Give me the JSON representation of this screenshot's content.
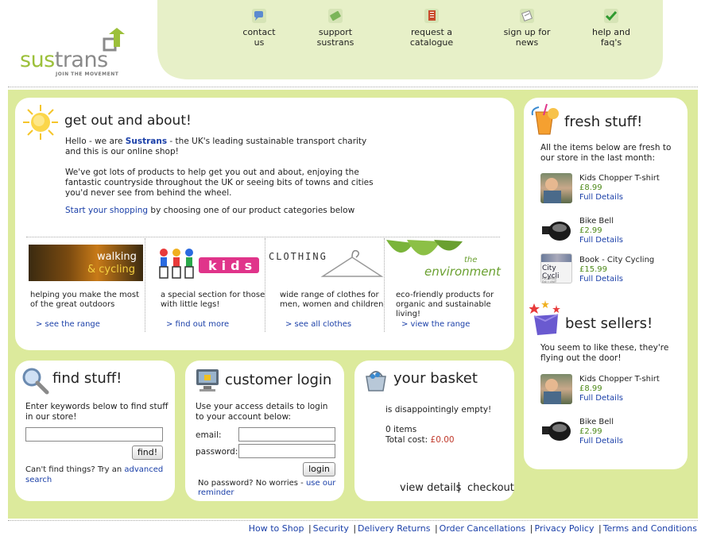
{
  "logo": {
    "word_a": "sus",
    "word_b": "trans",
    "tagline": "JOIN THE MOVEMENT"
  },
  "topnav": [
    {
      "label": "contact us"
    },
    {
      "label": "support sustrans"
    },
    {
      "label": "request a catalogue"
    },
    {
      "label": "sign up for news"
    },
    {
      "label": "help and faq's"
    }
  ],
  "intro": {
    "title": "get out and about!",
    "p1_a": "Hello - we are ",
    "p1_brand": "Sustrans",
    "p1_b": " - the UK's leading sustainable transport charity and this is our online shop!",
    "p2": "We've got lots of products to help get you out and about, enjoying the fantastic countryside throughout the UK or seeing bits of towns and cities you'd never see from behind the wheel.",
    "p3_link": "Start your shopping",
    "p3_rest": " by choosing one of our product categories below"
  },
  "categories": [
    {
      "banner_a": "walking",
      "banner_b": "& cycling",
      "desc": "helping you make the most of the great outdoors",
      "link": "> see the range"
    },
    {
      "banner": "kids",
      "desc": "a special section for those with little legs!",
      "link": "> find out more"
    },
    {
      "banner": "CLOTHING",
      "desc": "wide range of clothes for men, women and children",
      "link": "> see all clothes"
    },
    {
      "banner_a": "the",
      "banner_b": "environment",
      "desc": "eco-friendly products for organic and sustainable living!",
      "link": "> view the range"
    }
  ],
  "find": {
    "title": "find stuff!",
    "instructions": "Enter keywords below to find stuff in our store!",
    "search_value": "",
    "button": "find!",
    "help_a": "Can't find things? Try an ",
    "help_link": "advanced search"
  },
  "login": {
    "title": "customer login",
    "instructions": "Use your access details to login to your account below:",
    "email_label": "email:",
    "password_label": "password:",
    "button": "login",
    "forgot_a": "No password? No worries - ",
    "forgot_link": "use our reminder"
  },
  "basket": {
    "title": "your basket",
    "status": "is disappointingly empty!",
    "items": "0 items",
    "total_label": "Total cost: ",
    "total_value": "£0.00",
    "view_details": "view details",
    "divider": "|",
    "checkout": "checkout"
  },
  "fresh": {
    "title": "fresh stuff!",
    "intro": "All the items below are fresh to our store in the last month:",
    "items": [
      {
        "name": "Kids Chopper T-shirt",
        "price": "£8.99",
        "link": "Full Details"
      },
      {
        "name": "Bike Bell",
        "price": "£2.99",
        "link": "Full Details"
      },
      {
        "name": "Book - City Cycling",
        "price": "£15.99",
        "link": "Full Details",
        "thumb_text": "City Cycli",
        "thumb_sub": "RICHARD BALLANT"
      }
    ]
  },
  "best": {
    "title": "best sellers!",
    "intro": "You seem to like these, they're flying out the door!",
    "items": [
      {
        "name": "Kids Chopper T-shirt",
        "price": "£8.99",
        "link": "Full Details"
      },
      {
        "name": "Bike Bell",
        "price": "£2.99",
        "link": "Full Details"
      }
    ]
  },
  "footer": {
    "links": [
      "How to Shop",
      "Security",
      "Delivery Returns",
      "Order Cancellations",
      "Privacy Policy",
      "Terms and Conditions"
    ],
    "sep": "|"
  },
  "colors": {
    "brand_green": "#9cc03a",
    "panel_bg": "#dcea9c",
    "link_blue": "#1a3fa8",
    "price_green": "#4e8a1a"
  }
}
